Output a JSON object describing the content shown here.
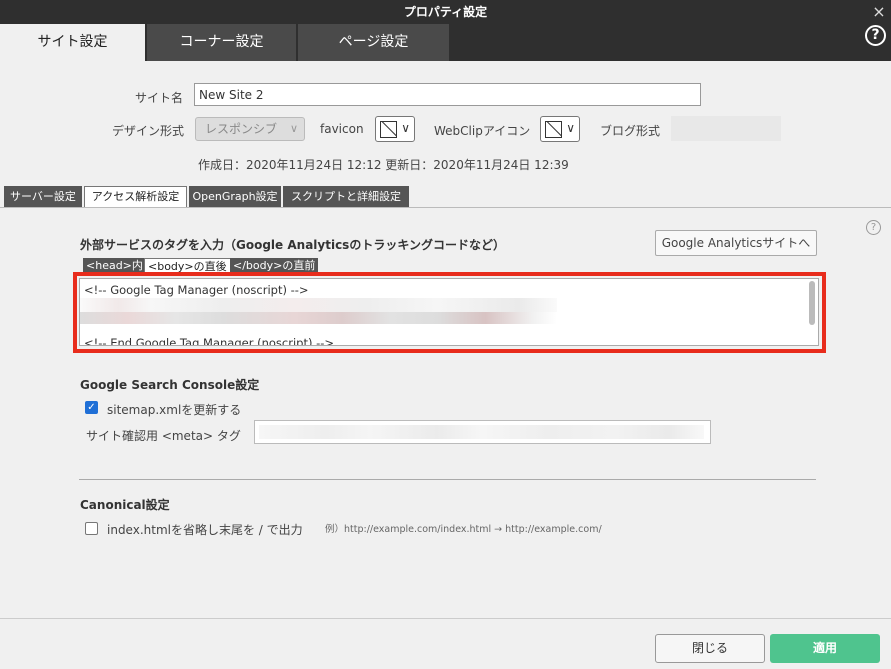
{
  "window": {
    "title": "プロパティ設定",
    "close_icon": "×",
    "help_icon": "?"
  },
  "main_tabs": [
    {
      "label": "サイト設定",
      "active": true
    },
    {
      "label": "コーナー設定",
      "active": false
    },
    {
      "label": "ページ設定",
      "active": false
    }
  ],
  "form": {
    "site_name_label": "サイト名",
    "site_name_value": "New Site 2",
    "design_label": "デザイン形式",
    "design_value": "レスポンシブ",
    "favicon_label": "favicon",
    "webclip_label": "WebClipアイコン",
    "blog_label": "ブログ形式",
    "dates": "作成日：2020年11月24日 12:12 更新日：2020年11月24日 12:39"
  },
  "sub_tabs": [
    {
      "label": "サーバー設定",
      "active": false
    },
    {
      "label": "アクセス解析設定",
      "active": true
    },
    {
      "label": "OpenGraph設定",
      "active": false
    },
    {
      "label": "スクリプトと詳細設定",
      "active": false
    }
  ],
  "tags": {
    "title": "外部サービスのタグを入力（Google Analyticsのトラッキングコードなど）",
    "ga_button": "Google Analyticsサイトへ",
    "tabs": [
      {
        "label": "<head>内",
        "active": false
      },
      {
        "label": "<body>の直後",
        "active": true
      },
      {
        "label": "</body>の直前",
        "active": false
      }
    ],
    "code_lines": [
      "<!-- Google Tag Manager (noscript) -->",
      "<!-- End Google Tag Manager (noscript) -->"
    ],
    "highlight_color": "#e82c1c"
  },
  "gsc": {
    "title": "Google Search Console設定",
    "sitemap_label": "sitemap.xmlを更新する",
    "sitemap_checked": true,
    "meta_label": "サイト確認用 <meta> タグ"
  },
  "canonical": {
    "title": "Canonical設定",
    "option_label": "index.htmlを省略し末尾を / で出力",
    "option_checked": false,
    "example": "例）http://example.com/index.html → http://example.com/"
  },
  "footer": {
    "close_label": "閉じる",
    "apply_label": "適用",
    "apply_color": "#4fc48e"
  }
}
